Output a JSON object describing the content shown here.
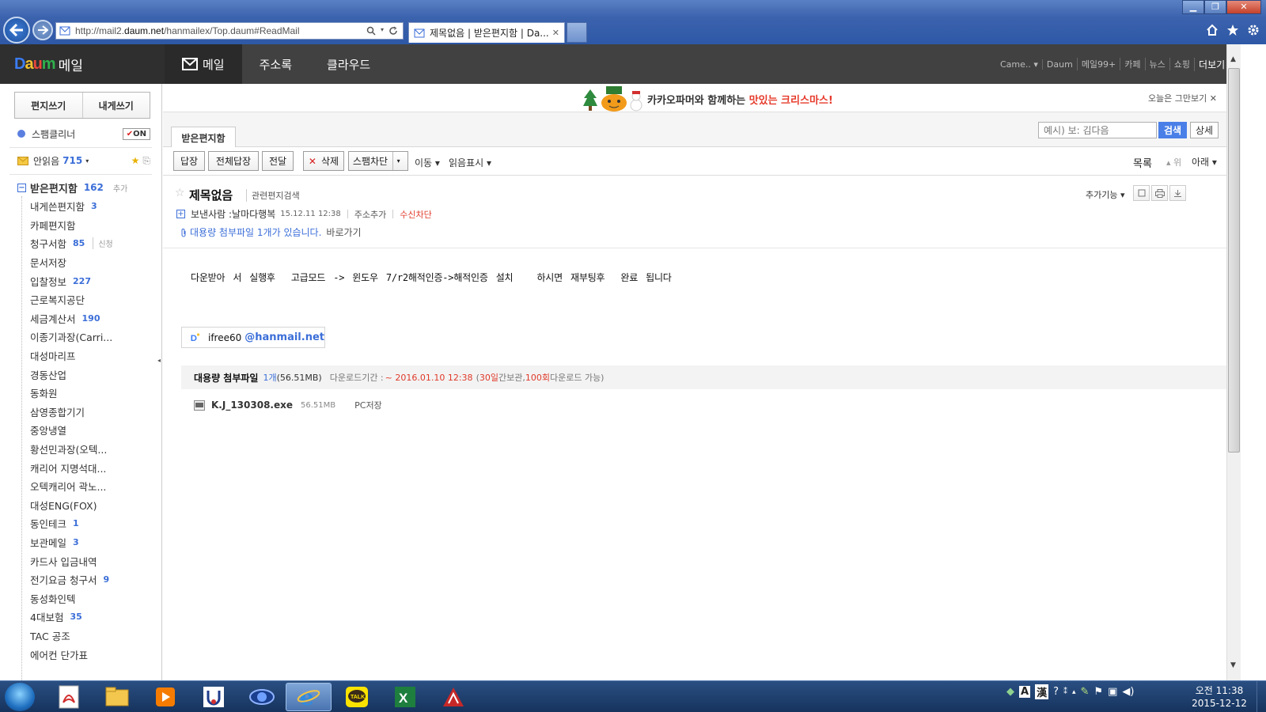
{
  "browser": {
    "url_prefix": "http://mail2.",
    "url_domain": "daum.net",
    "url_path": "/hanmailex/Top.daum#ReadMail",
    "tab_title": "제목없음 | 받은편지함 | Da...",
    "tab_close": "✕"
  },
  "header": {
    "logo_text": "메일",
    "nav": [
      "메일",
      "주소록",
      "클라우드"
    ],
    "top_links": [
      "Came.. ▾",
      "Daum",
      "메일99+",
      "카페",
      "뉴스",
      "쇼핑"
    ],
    "more": "더보기 ▾"
  },
  "sidebar": {
    "compose": "편지쓰기",
    "self_compose": "내게쓰기",
    "spam_cleaner": "스팸클리너",
    "spam_toggle": "ON",
    "unread_label": "안읽음",
    "unread_count": "715",
    "inbox_label": "받은편지함",
    "inbox_count": "162",
    "inbox_add": "추가",
    "folders": [
      {
        "name": "내게쓴편지함",
        "count": "3"
      },
      {
        "name": "카페편지함",
        "count": ""
      },
      {
        "name": "청구서함",
        "count": "85",
        "extra": "신청"
      },
      {
        "name": "문서저장",
        "count": ""
      },
      {
        "name": "입찰정보",
        "count": "227"
      },
      {
        "name": "근로복지공단",
        "count": ""
      },
      {
        "name": "세금계산서",
        "count": "190"
      },
      {
        "name": "이종기과장(Carri...",
        "count": ""
      },
      {
        "name": "대성마리프",
        "count": ""
      },
      {
        "name": "경동산업",
        "count": ""
      },
      {
        "name": "동화원",
        "count": ""
      },
      {
        "name": "삼영종합기기",
        "count": ""
      },
      {
        "name": "중앙냉열",
        "count": ""
      },
      {
        "name": "황선민과장(오텍...",
        "count": ""
      },
      {
        "name": "캐리어 지명석대...",
        "count": ""
      },
      {
        "name": "오텍캐리어 곽노...",
        "count": ""
      },
      {
        "name": "대성ENG(FOX)",
        "count": ""
      },
      {
        "name": "동인테크",
        "count": "1"
      },
      {
        "name": "보관메일",
        "count": "3"
      },
      {
        "name": "카드사 입금내역",
        "count": ""
      },
      {
        "name": "전기요금 청구서",
        "count": "9"
      },
      {
        "name": "동성화인텍",
        "count": ""
      },
      {
        "name": "4대보험",
        "count": "35"
      },
      {
        "name": "TAC 공조",
        "count": ""
      },
      {
        "name": "에어컨 단가표",
        "count": ""
      }
    ]
  },
  "banner": {
    "text_before": "카카오파머와 함께하는 ",
    "text_highlight": "맛있는 크리스마스!",
    "close": "오늘은 그만보기 ✕"
  },
  "folder_tab": "받은편지함",
  "search": {
    "placeholder": "예시) 보: 김다음",
    "button": "검색",
    "detail": "상세"
  },
  "toolbar": {
    "reply": "답장",
    "reply_all": "전체답장",
    "forward": "전달",
    "delete": "삭제",
    "spam_block": "스팸차단",
    "move": "이동 ▾",
    "read_mark": "읽음표시 ▾",
    "list": "목록",
    "up": "▴ 위",
    "down": "아래 ▾"
  },
  "message": {
    "subject": "제목없음",
    "related": "관련편지검색",
    "more_functions": "추가기능 ▾",
    "sender_label": "보낸사람 : ",
    "sender_name": "날마다행복",
    "date": "15.12.11 12:38",
    "add_address": "주소추가",
    "block_receive": "수신차단",
    "attach_notice": "대용량 첨부파일 1개가 있습니다.",
    "attach_go": "바로가기",
    "body": "다운받아 서 실행후  고급모드 -> 윈도우 7/r2해적인증->해적인증 설치   하시면 재부팅후  완료 됩니다",
    "signature_id": "ifree60",
    "signature_domain": "@hanmail.net",
    "large_attach_title": "대용량 첨부파일",
    "large_attach_count": "1개",
    "large_attach_size": "(56.51MB)",
    "download_period_label": "다운로드기간 :",
    "download_period_value": "~ 2016.01.10 12:38",
    "retention_open": "(",
    "retention_days": "30일",
    "retention_mid": "간보관,",
    "retention_times": "100회",
    "retention_close": " 다운로드 가능)",
    "file_name": "K.J_130308.exe",
    "file_size": "56.51MB",
    "pc_save": "PC저장"
  },
  "taskbar": {
    "ime_a": "A",
    "ime_han": "漢",
    "clock_time": "오전 11:38",
    "clock_date": "2015-12-12"
  }
}
